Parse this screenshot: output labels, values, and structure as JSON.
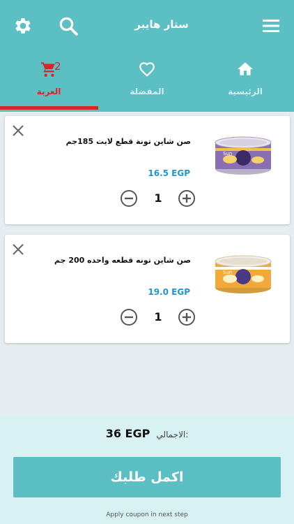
{
  "appbar": {
    "title": "ستار هايبر",
    "colors": {
      "accent": "#5bbfc4",
      "active": "#d7252c",
      "price": "#2196d3"
    }
  },
  "tabs": [
    {
      "label": "العربة",
      "icon": "cart-icon",
      "badge": "2",
      "active": true
    },
    {
      "label": "المفضلة",
      "icon": "heart-icon",
      "active": false
    },
    {
      "label": "الرئيسية",
      "icon": "home-icon",
      "active": false
    }
  ],
  "cart": {
    "items": [
      {
        "name": "صن شاين تونة قطع لايت 185جم",
        "price": "16.5 EGP",
        "quantity": "1",
        "image": "tuna-can-purple"
      },
      {
        "name": "صن شاين تونه قطعه واحده 200 جم",
        "price": "19.0 EGP",
        "quantity": "1",
        "image": "tuna-can-orange"
      }
    ]
  },
  "footer": {
    "total_label": "الاجمالي:",
    "total_value": "36 EGP",
    "checkout_label": "اكمل طلبك",
    "coupon_note": "Apply coupon in next step"
  }
}
